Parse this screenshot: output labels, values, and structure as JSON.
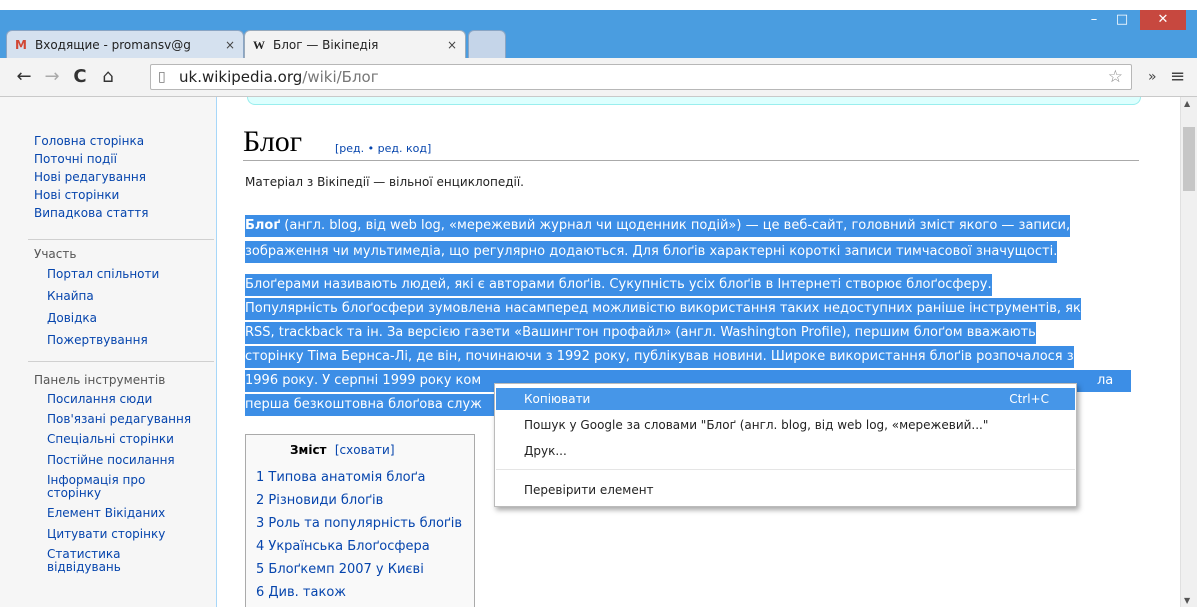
{
  "window": {
    "minimize": "–",
    "maximize": "□",
    "close": "✕"
  },
  "tabs": [
    {
      "favicon": "M",
      "title": "Входящие - promansv@g",
      "close": "×"
    },
    {
      "favicon": "W",
      "title": "Блог — Вікіпедія",
      "close": "×"
    }
  ],
  "toolbar": {
    "back": "←",
    "forward": "→",
    "reload": "C",
    "home": "⌂",
    "url_host": "uk.wikipedia.org",
    "url_path": "/wiki/Блог",
    "star": "☆",
    "extensions": "»",
    "menu": "≡"
  },
  "sidebar": {
    "main_links": [
      "Головна сторінка",
      "Поточні події",
      "Нові редагування",
      "Нові сторінки",
      "Випадкова стаття"
    ],
    "participation_heading": "Участь",
    "participation_links": [
      "Портал спільноти",
      "Кнайпа",
      "Довідка",
      "Пожертвування"
    ],
    "tools_heading": "Панель інструментів",
    "tools_links": [
      "Посилання сюди",
      "Пов'язані редагування",
      "Спеціальні сторінки",
      "Постійне посилання",
      "Інформація про сторінку",
      "Елемент Вікіданих",
      "Цитувати сторінку",
      "Статистика відвідувань"
    ]
  },
  "article": {
    "title": "Блог",
    "edit_links": "[ред. • ред. код]",
    "subtitle": "Матеріал з Вікіпедії — вільної енциклопедії.",
    "p1_line1_bold": "Блоґ",
    "p1_line1_rest": " (англ. blog, від web log, «мережевий журнал чи щоденник подій») — це веб-сайт, головний зміст якого — записи,",
    "p1_line2": "зображення чи мультимедіа, що регулярно додаються. Для блоґів характерні короткі записи тимчасової значущості.",
    "p2_line1": "Блоґерами називають людей, які є авторами блоґів. Сукупність усіх блоґів в Інтернеті створює блоґосферу.",
    "p2_line2": "Популярність блоґосфери зумовлена насамперед можливістю використання таких недоступних раніше інструментів, як",
    "p2_line3": "RSS, trackback та ін. За версією газети «Вашингтон профайл» (англ. Washington Profile), першим блоґом вважають",
    "p2_line4": "сторінку Тіма Бернса-Лі, де він, починаючи з 1992 року, публікував новини. Широке використання блоґів розпочалося з",
    "p2_line5": "1996 року. У серпні 1999 року ком",
    "p2_line5_tail": "ла",
    "p2_line6": "перша безкоштовна блоґова служ"
  },
  "toc": {
    "title": "Зміст",
    "toggle": "[сховати]",
    "items": [
      "1 Типова анатомія блоґа",
      "2 Різновиди блоґів",
      "3 Роль та популярність блоґів",
      "4 Українська Блоґосфера",
      "5 Блоґкемп 2007 у Києві",
      "6 Див. також"
    ]
  },
  "context_menu": {
    "copy": "Копіювати",
    "copy_shortcut": "Ctrl+C",
    "search": "Пошук у Google за словами \"Блоґ (англ. blog, від web log, «мережевий...\"",
    "print": "Друк...",
    "inspect": "Перевірити елемент"
  }
}
